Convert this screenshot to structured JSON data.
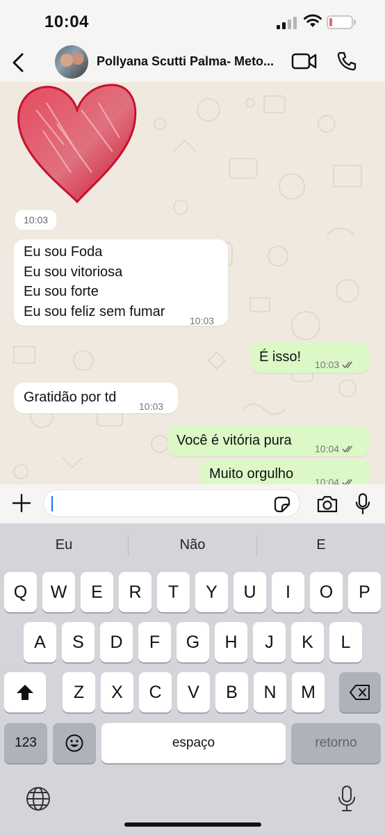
{
  "status_bar": {
    "time": "10:04",
    "battery": "8",
    "battery_level_percent": 8
  },
  "header": {
    "contact_name": "Pollyana Scutti Palma- Meto..."
  },
  "chat": {
    "sticker_time": "10:03",
    "messages": [
      {
        "direction": "in",
        "lines": [
          "Eu sou Foda",
          "Eu sou vitoriosa",
          "Eu sou forte",
          "Eu sou feliz sem fumar"
        ],
        "time": "10:03"
      },
      {
        "direction": "out",
        "text": "É isso!",
        "time": "10:03",
        "status": "read"
      },
      {
        "direction": "in",
        "text": "Gratidão por td",
        "time": "10:03"
      },
      {
        "direction": "out",
        "text": "Você é vitória pura",
        "time": "10:04",
        "status": "read"
      },
      {
        "direction": "out",
        "text": "Muito orgulho",
        "time": "10:04",
        "status": "read"
      }
    ]
  },
  "input": {
    "value": ""
  },
  "keyboard": {
    "suggestions": [
      "Eu",
      "Não",
      "E"
    ],
    "row1": [
      "Q",
      "W",
      "E",
      "R",
      "T",
      "Y",
      "U",
      "I",
      "O",
      "P"
    ],
    "row2": [
      "A",
      "S",
      "D",
      "F",
      "G",
      "H",
      "J",
      "K",
      "L"
    ],
    "row3": [
      "Z",
      "X",
      "C",
      "V",
      "B",
      "N",
      "M"
    ],
    "numbers_key": "123",
    "space_key": "espaço",
    "return_key": "retorno"
  },
  "colors": {
    "outgoing_bubble": "#dbf8c6",
    "incoming_bubble": "#ffffff",
    "read_ticks": "#6b6b6b",
    "keyboard_bg": "#d3d5da"
  },
  "icons": [
    "back-icon",
    "video-call-icon",
    "phone-icon",
    "plus-icon",
    "sticker-icon",
    "camera-icon",
    "mic-icon",
    "shift-icon",
    "backspace-icon",
    "emoji-icon",
    "globe-icon",
    "dictation-icon"
  ]
}
